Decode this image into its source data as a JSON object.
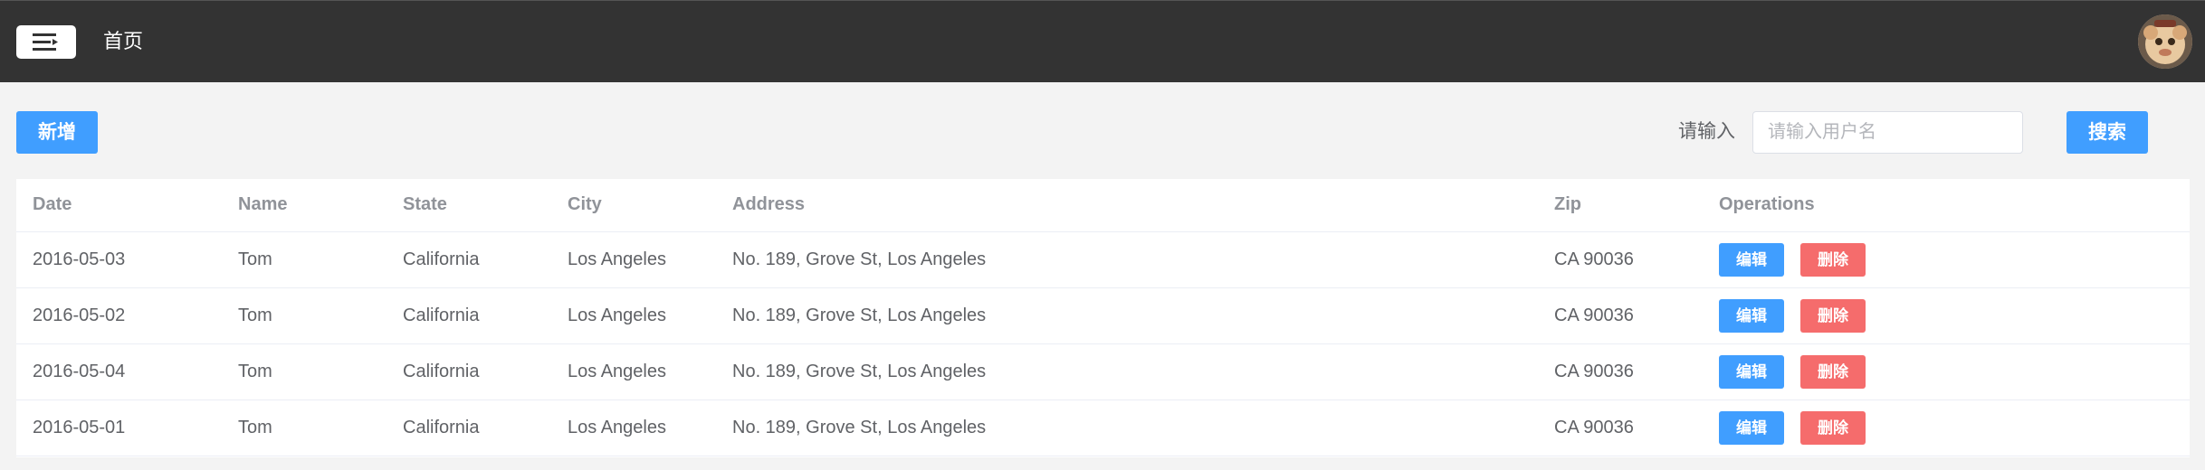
{
  "header": {
    "menu_icon": "menu-fold-icon",
    "nav_title": "首页",
    "avatar_icon": "avatar-image"
  },
  "toolbar": {
    "add_label": "新增",
    "search_label": "请输入",
    "search_placeholder": "请输入用户名",
    "search_value": "",
    "search_button_label": "搜索"
  },
  "table": {
    "columns": [
      "Date",
      "Name",
      "State",
      "City",
      "Address",
      "Zip",
      "Operations"
    ],
    "edit_label": "编辑",
    "delete_label": "删除",
    "rows": [
      {
        "date": "2016-05-03",
        "name": "Tom",
        "state": "California",
        "city": "Los Angeles",
        "address": "No. 189, Grove St, Los Angeles",
        "zip": "CA 90036"
      },
      {
        "date": "2016-05-02",
        "name": "Tom",
        "state": "California",
        "city": "Los Angeles",
        "address": "No. 189, Grove St, Los Angeles",
        "zip": "CA 90036"
      },
      {
        "date": "2016-05-04",
        "name": "Tom",
        "state": "California",
        "city": "Los Angeles",
        "address": "No. 189, Grove St, Los Angeles",
        "zip": "CA 90036"
      },
      {
        "date": "2016-05-01",
        "name": "Tom",
        "state": "California",
        "city": "Los Angeles",
        "address": "No. 189, Grove St, Los Angeles",
        "zip": "CA 90036"
      }
    ]
  },
  "colors": {
    "topbar": "#333333",
    "primary": "#409eff",
    "danger": "#f56c6c",
    "background": "#f3f3f3"
  }
}
